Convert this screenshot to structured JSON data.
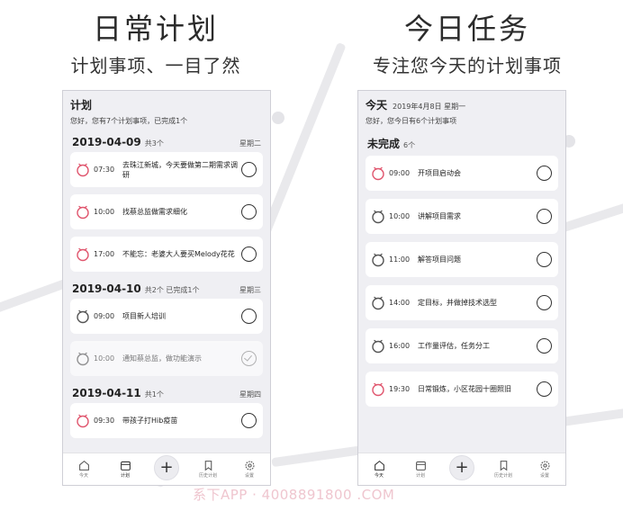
{
  "left_panel": {
    "promo_title": "日常计划",
    "promo_subtitle": "计划事项、一目了然",
    "screen": {
      "title": "计划",
      "greeting": "您好，您有7个计划事项，已完成1个",
      "groups": [
        {
          "date": "2019-04-09",
          "count": "共3个",
          "weekday": "星期二",
          "tasks": [
            {
              "time": "07:30",
              "text": "去珠江新城，今天要做第二期需求调研",
              "done": false,
              "clock_color": "#e0566e"
            },
            {
              "time": "10:00",
              "text": "找蔡总监做需求细化",
              "done": false,
              "clock_color": "#e0566e"
            },
            {
              "time": "17:00",
              "text": "不能忘：老婆大人要买Melody花花",
              "done": false,
              "clock_color": "#e0566e"
            }
          ]
        },
        {
          "date": "2019-04-10",
          "count": "共2个 已完成1个",
          "weekday": "星期三",
          "tasks": [
            {
              "time": "09:00",
              "text": "项目新人培训",
              "done": false,
              "clock_color": "#555555"
            },
            {
              "time": "10:00",
              "text": "通知蔡总监，做功能演示",
              "done": true,
              "clock_color": "#555555"
            }
          ]
        },
        {
          "date": "2019-04-11",
          "count": "共1个",
          "weekday": "星期四",
          "tasks": [
            {
              "time": "09:30",
              "text": "带孩子打Hib疫苗",
              "done": false,
              "clock_color": "#e0566e"
            }
          ]
        }
      ],
      "tabbar": {
        "home": "今天",
        "plan": "计划",
        "history": "历史计划",
        "settings": "设置",
        "add": "+"
      }
    }
  },
  "right_panel": {
    "promo_title": "今日任务",
    "promo_subtitle": "专注您今天的计划事项",
    "screen": {
      "title": "今天",
      "date": "2019年4月8日 星期一",
      "greeting": "您好，您今日有6个计划事项",
      "section_title": "未完成",
      "section_count": "6个",
      "tasks": [
        {
          "time": "09:00",
          "text": "开项目启动会",
          "clock_color": "#e0566e"
        },
        {
          "time": "10:00",
          "text": "讲解项目需求",
          "clock_color": "#555555"
        },
        {
          "time": "11:00",
          "text": "解答项目问题",
          "clock_color": "#555555"
        },
        {
          "time": "14:00",
          "text": "定目标，并做掉技术选型",
          "clock_color": "#555555"
        },
        {
          "time": "16:00",
          "text": "工作量评估，任务分工",
          "clock_color": "#555555"
        },
        {
          "time": "19:30",
          "text": "日常锻炼，小区花园十圈照旧",
          "clock_color": "#e0566e"
        }
      ],
      "tabbar": {
        "home": "今天",
        "plan": "计划",
        "history": "历史计划",
        "settings": "设置",
        "add": "+"
      }
    }
  },
  "watermark": "系下APP · 4008891800 .COM"
}
